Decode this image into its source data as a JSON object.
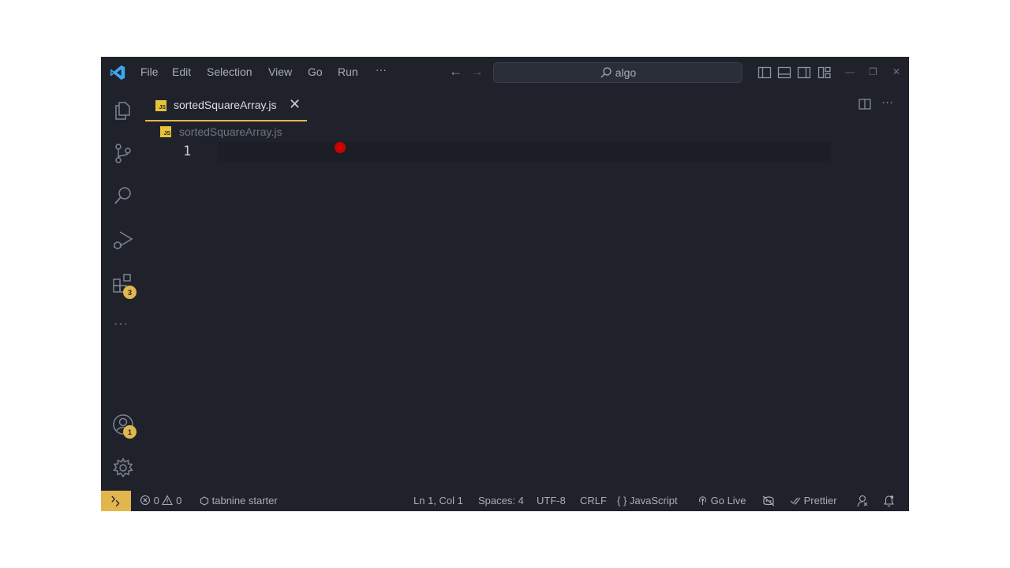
{
  "menu": [
    "File",
    "Edit",
    "Selection",
    "View",
    "Go",
    "Run",
    "···"
  ],
  "search": {
    "text": "algo"
  },
  "activity": {
    "extensions_badge": "3",
    "accounts_badge": "1",
    "more": "···"
  },
  "tab": {
    "label": "sortedSquareArray.js",
    "icon": "JS",
    "close": "✕"
  },
  "editor_actions": {
    "more": "···"
  },
  "breadcrumb": {
    "file": "sortedSquareArray.js"
  },
  "editor": {
    "line_number": "1"
  },
  "status": {
    "errors": "0",
    "warnings": "0",
    "tabnine": "tabnine starter",
    "position": "Ln 1, Col 1",
    "spaces": "Spaces: 4",
    "encoding": "UTF-8",
    "eol": "CRLF",
    "language": "JavaScript",
    "language_braces": "{ }",
    "golive": "Go Live",
    "prettier": "Prettier"
  },
  "colors": {
    "background": "#1f222a",
    "accent": "#e2b64f",
    "js_badge": "#e6c33a",
    "cursor_marker": "#cc0000"
  }
}
